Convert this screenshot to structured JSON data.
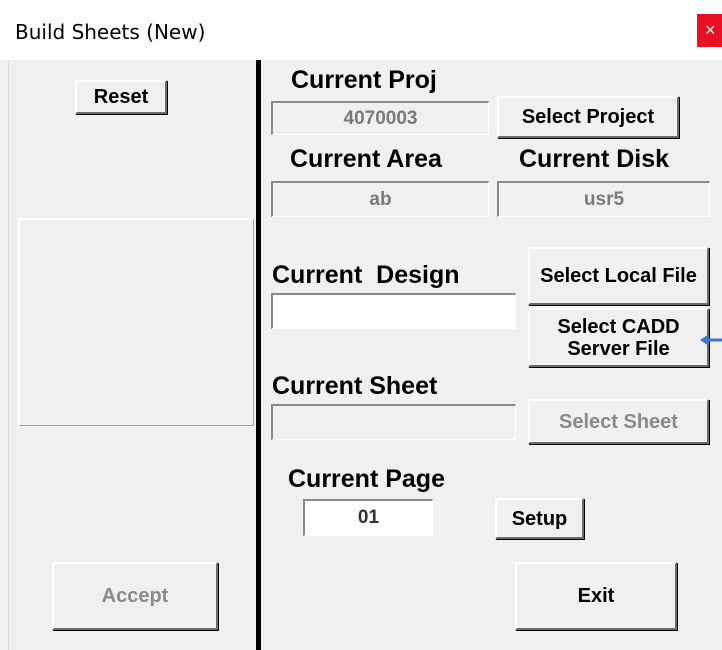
{
  "window": {
    "title": "Build Sheets (New)",
    "close_glyph": "×"
  },
  "left_panel": {
    "reset_label": "Reset",
    "accept_label": "Accept"
  },
  "project": {
    "label": "Current Proj",
    "value": "4070003",
    "select_label": "Select Project"
  },
  "area": {
    "label": "Current Area",
    "value": "ab"
  },
  "disk": {
    "label": "Current Disk",
    "value": "usr5"
  },
  "design": {
    "label": "Current  Design",
    "value": "",
    "select_local_label": "Select Local File",
    "select_cadd_label": "Select CADD Server File"
  },
  "sheet": {
    "label": "Current Sheet",
    "value": "",
    "select_label": "Select Sheet"
  },
  "page": {
    "label": "Current Page",
    "value": "01",
    "setup_label": "Setup"
  },
  "exit_label": "Exit",
  "colors": {
    "close_bg": "#e81123",
    "divider": "#000000",
    "face": "#f0f0f0",
    "disabled_text": "#8a8a8a",
    "arrow": "#3c78c8"
  },
  "icons": {
    "close": "close-icon",
    "annotation_arrow": "arrow-left-icon"
  }
}
